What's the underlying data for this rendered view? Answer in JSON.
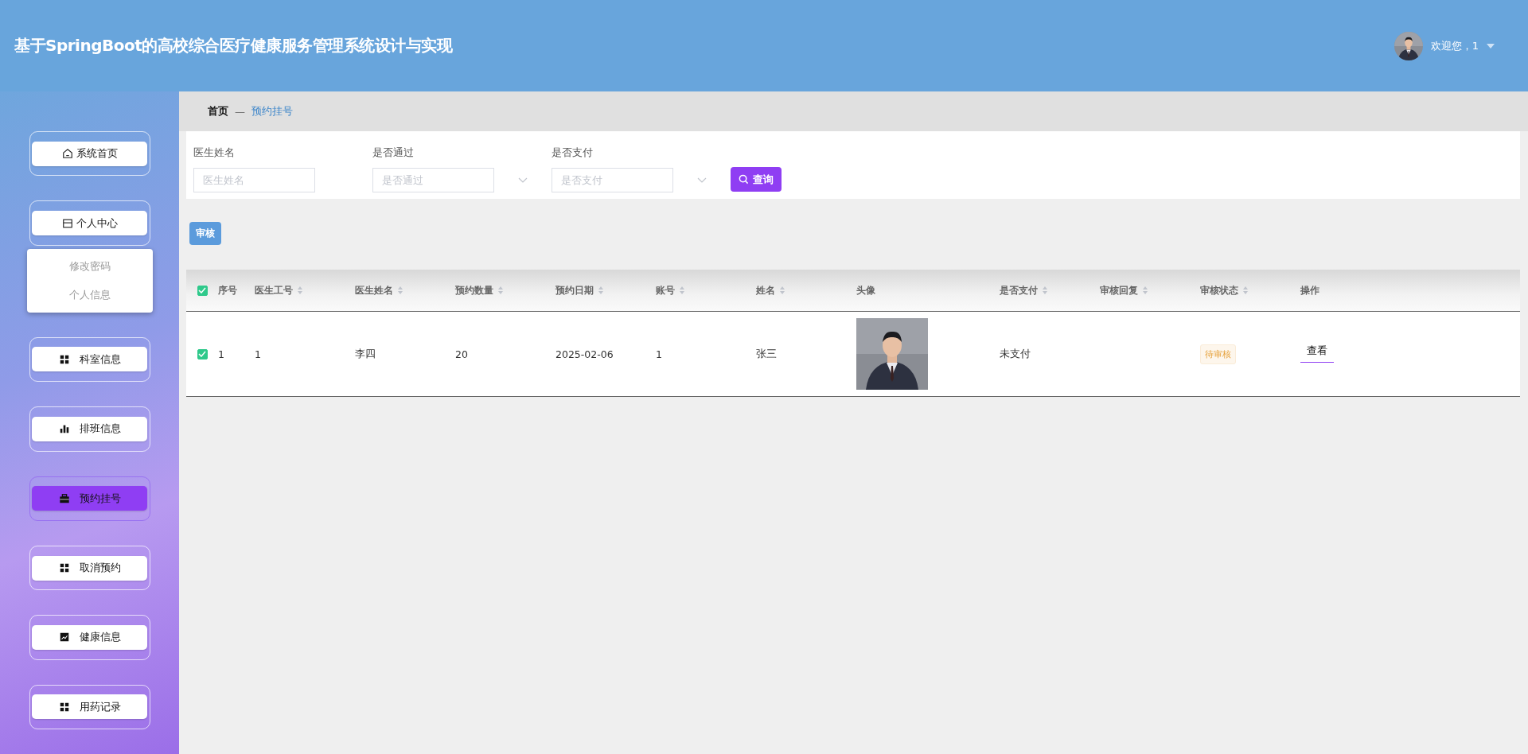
{
  "header": {
    "title": "基于SpringBoot的高校综合医疗健康服务管理系统设计与实现",
    "greeting": "欢迎您，1"
  },
  "sidebar": {
    "items": [
      {
        "label": "系统首页",
        "selected": false
      },
      {
        "label": "个人中心",
        "selected": false,
        "expanded": true,
        "children": [
          {
            "label": "修改密码"
          },
          {
            "label": "个人信息"
          }
        ]
      },
      {
        "label": "科室信息",
        "selected": false
      },
      {
        "label": "排班信息",
        "selected": false
      },
      {
        "label": "预约挂号",
        "selected": true
      },
      {
        "label": "取消预约",
        "selected": false
      },
      {
        "label": "健康信息",
        "selected": false
      },
      {
        "label": "用药记录",
        "selected": false
      }
    ]
  },
  "breadcrumb": {
    "items": [
      "首页",
      "预约挂号"
    ],
    "separator": "—"
  },
  "search": {
    "fields": [
      {
        "label": "医生姓名",
        "placeholder": "医生姓名",
        "kind": "input"
      },
      {
        "label": "是否通过",
        "placeholder": "是否通过",
        "kind": "select"
      },
      {
        "label": "是否支付",
        "placeholder": "是否支付",
        "kind": "select"
      }
    ],
    "button": "查询"
  },
  "actions": [
    "审核"
  ],
  "table": {
    "all_checked": true,
    "columns": [
      {
        "label": "序号",
        "sortable": false
      },
      {
        "label": "医生工号",
        "sortable": true
      },
      {
        "label": "医生姓名",
        "sortable": true
      },
      {
        "label": "预约数量",
        "sortable": true
      },
      {
        "label": "预约日期",
        "sortable": true
      },
      {
        "label": "账号",
        "sortable": true
      },
      {
        "label": "姓名",
        "sortable": true
      },
      {
        "label": "头像",
        "sortable": false
      },
      {
        "label": "是否支付",
        "sortable": true
      },
      {
        "label": "审核回复",
        "sortable": true
      },
      {
        "label": "审核状态",
        "sortable": true
      },
      {
        "label": "操作",
        "sortable": false
      }
    ],
    "rows": [
      {
        "checked": true,
        "cells": [
          {
            "kind": "text",
            "value": "1"
          },
          {
            "kind": "text",
            "value": "1"
          },
          {
            "kind": "text",
            "value": "李四"
          },
          {
            "kind": "text",
            "value": "20"
          },
          {
            "kind": "text",
            "value": "2025-02-06"
          },
          {
            "kind": "text",
            "value": "1"
          },
          {
            "kind": "text",
            "value": "张三"
          },
          {
            "kind": "picture"
          },
          {
            "kind": "text",
            "value": "未支付"
          },
          {
            "kind": "empty"
          },
          {
            "kind": "tag",
            "value": "待审核"
          },
          {
            "kind": "link",
            "value": "查看"
          }
        ]
      }
    ]
  }
}
